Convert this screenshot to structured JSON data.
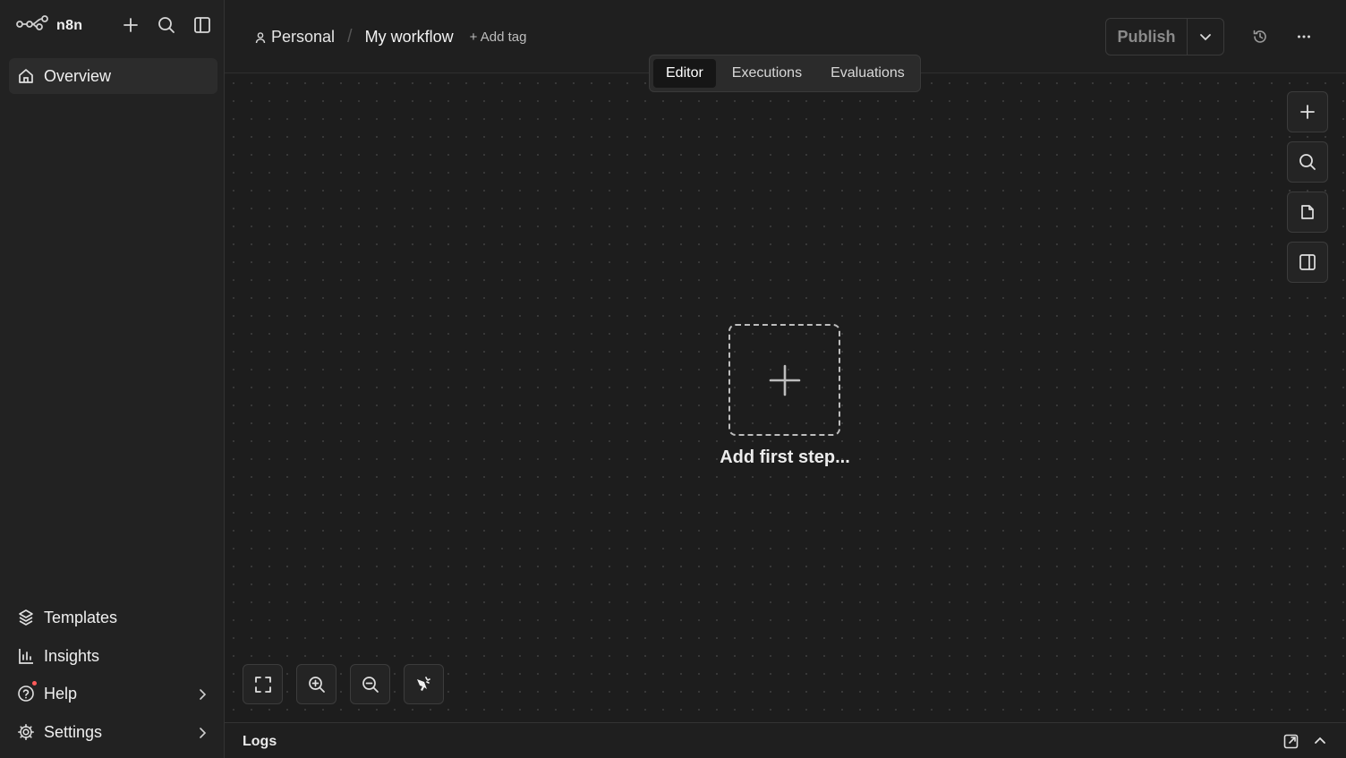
{
  "sidebar": {
    "brand": "n8n",
    "top_icons": [
      "plus-icon",
      "search-icon",
      "panel-toggle-icon"
    ],
    "nav_top": [
      {
        "label": "Overview",
        "icon": "home-icon",
        "active": true
      }
    ],
    "nav_bottom": [
      {
        "label": "Templates",
        "icon": "templates-icon"
      },
      {
        "label": "Insights",
        "icon": "chart-icon"
      },
      {
        "label": "Help",
        "icon": "help-icon",
        "has_badge": true,
        "has_submenu": true
      },
      {
        "label": "Settings",
        "icon": "gear-icon",
        "has_submenu": true
      }
    ]
  },
  "header": {
    "project": "Personal",
    "separator": "/",
    "workflow_name": "My workflow",
    "add_tag": "+ Add tag",
    "publish_label": "Publish"
  },
  "tabs": [
    {
      "label": "Editor",
      "active": true
    },
    {
      "label": "Executions"
    },
    {
      "label": "Evaluations"
    }
  ],
  "canvas": {
    "right_tools": [
      "plus-icon",
      "search-icon",
      "sticky-note-icon",
      "panel-icon"
    ],
    "empty_label": "Add first step...",
    "bottom_tools": [
      "fit-view-icon",
      "zoom-in-icon",
      "zoom-out-icon",
      "tidy-up-icon"
    ]
  },
  "logs": {
    "label": "Logs"
  },
  "colors": {
    "background": "#1f1f1f",
    "sidebar": "#222222",
    "active_item": "#2c2c2c",
    "badge": "#ff5a5a"
  }
}
